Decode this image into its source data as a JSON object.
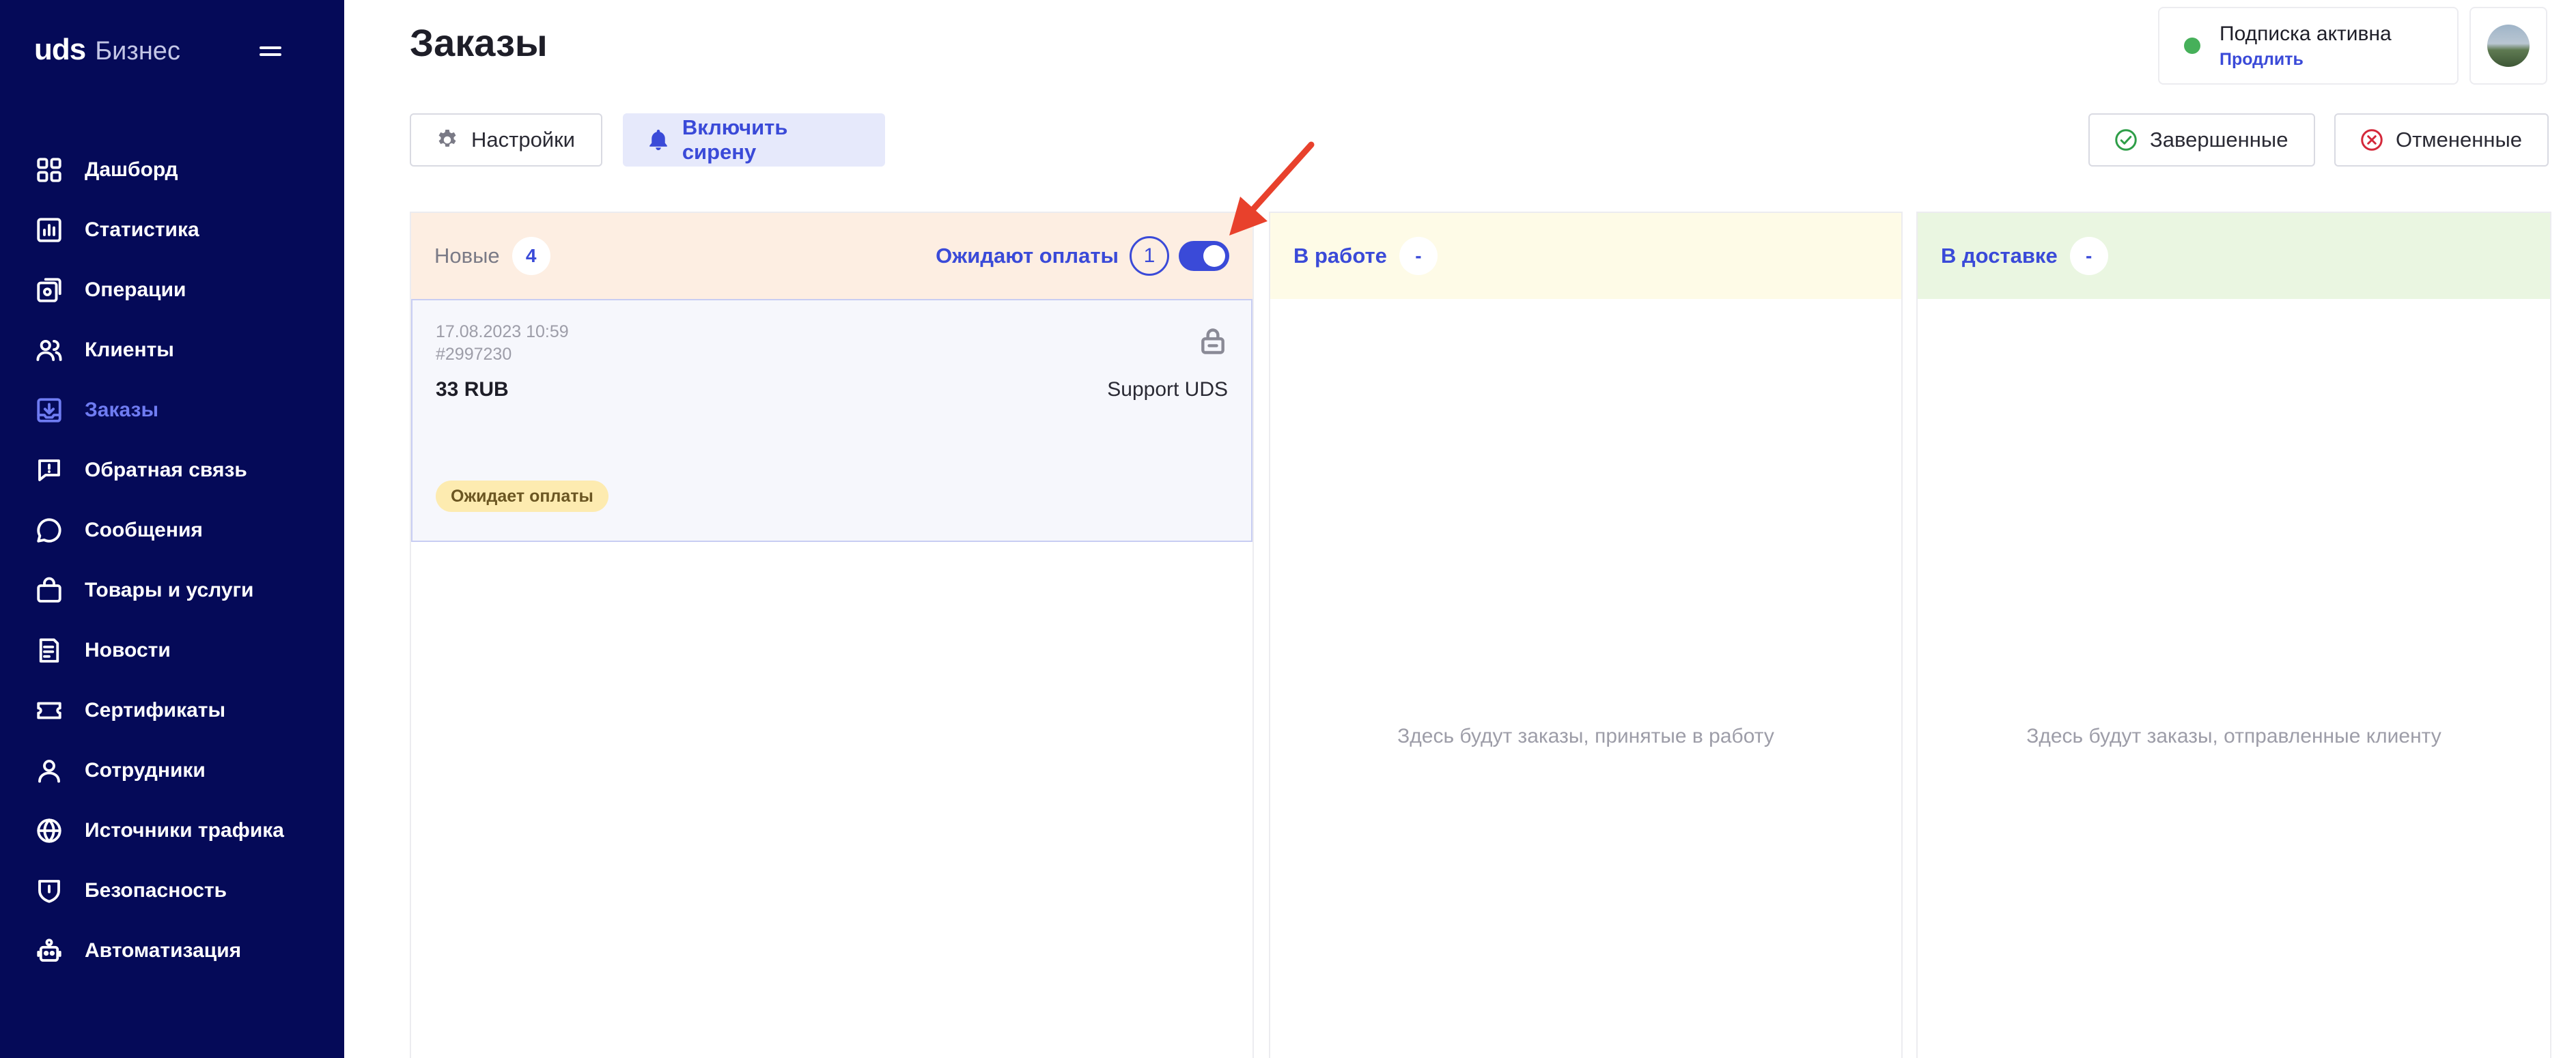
{
  "sidebar": {
    "brand_name": "uds",
    "brand_suffix": "Бизнес",
    "items": [
      {
        "label": "Дашборд",
        "icon": "dashboard-icon"
      },
      {
        "label": "Статистика",
        "icon": "chart-icon"
      },
      {
        "label": "Операции",
        "icon": "operations-icon"
      },
      {
        "label": "Клиенты",
        "icon": "clients-icon"
      },
      {
        "label": "Заказы",
        "icon": "orders-icon",
        "active": true
      },
      {
        "label": "Обратная связь",
        "icon": "feedback-icon"
      },
      {
        "label": "Сообщения",
        "icon": "messages-icon"
      },
      {
        "label": "Товары и услуги",
        "icon": "bag-icon"
      },
      {
        "label": "Новости",
        "icon": "news-icon"
      },
      {
        "label": "Сертификаты",
        "icon": "ticket-icon"
      },
      {
        "label": "Сотрудники",
        "icon": "person-icon"
      },
      {
        "label": "Источники трафика",
        "icon": "globe-icon"
      },
      {
        "label": "Безопасность",
        "icon": "shield-icon"
      },
      {
        "label": "Автоматизация",
        "icon": "robot-icon"
      }
    ]
  },
  "header": {
    "title": "Заказы",
    "subscription_status": "Подписка активна",
    "subscription_renew": "Продлить"
  },
  "toolbar": {
    "settings_label": "Настройки",
    "siren_label": "Включить сирену",
    "completed_label": "Завершенные",
    "cancelled_label": "Отмененные"
  },
  "columns": {
    "new": {
      "title": "Новые",
      "count": "4",
      "awaiting_label": "Ожидают оплаты",
      "awaiting_count": "1",
      "awaiting_toggle_on": true
    },
    "in_work": {
      "title": "В работе",
      "count": "-",
      "empty_text": "Здесь будут заказы, принятые в работу"
    },
    "delivery": {
      "title": "В доставке",
      "count": "-",
      "empty_text": "Здесь будут заказы, отправленные клиенту"
    }
  },
  "order": {
    "datetime": "17.08.2023 10:59",
    "id": "#2997230",
    "amount": "33 RUB",
    "client": "Support UDS",
    "status": "Ожидает оплаты"
  },
  "colors": {
    "sidebar_bg": "#050a58",
    "accent": "#3a4ad8",
    "active_nav": "#6f7cf2",
    "annotation_arrow": "#e8412c"
  }
}
